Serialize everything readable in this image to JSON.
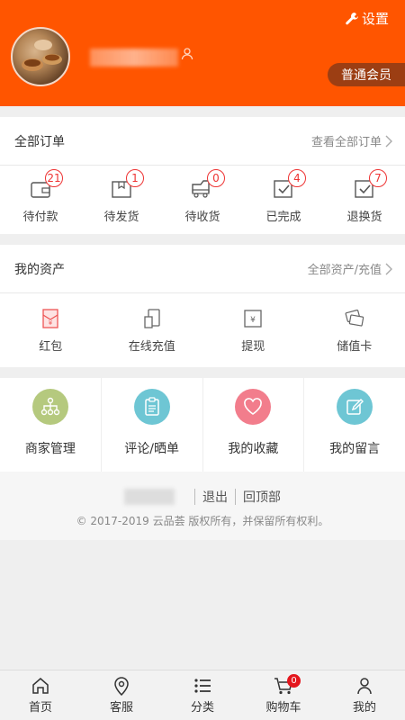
{
  "header": {
    "settings_label": "设置",
    "member_label": "普通会员",
    "accent": "#ff5500"
  },
  "orders": {
    "title": "全部订单",
    "link": "查看全部订单",
    "items": [
      {
        "label": "待付款",
        "badge": "21",
        "icon": "wallet-icon"
      },
      {
        "label": "待发货",
        "badge": "1",
        "icon": "package-icon"
      },
      {
        "label": "待收货",
        "badge": "0",
        "icon": "truck-icon"
      },
      {
        "label": "已完成",
        "badge": "4",
        "icon": "checkbox-icon"
      },
      {
        "label": "退换货",
        "badge": "7",
        "icon": "return-icon"
      }
    ]
  },
  "assets": {
    "title": "我的资产",
    "link": "全部资产/充值",
    "items": [
      {
        "label": "红包",
        "icon": "red-packet-icon"
      },
      {
        "label": "在线充值",
        "icon": "recharge-icon"
      },
      {
        "label": "提现",
        "icon": "withdraw-icon"
      },
      {
        "label": "储值卡",
        "icon": "cards-icon"
      }
    ]
  },
  "tools": [
    {
      "label": "商家管理",
      "icon": "org-chart-icon",
      "color": "#b5c97e"
    },
    {
      "label": "评论/晒单",
      "icon": "clipboard-icon",
      "color": "#6ec6d4"
    },
    {
      "label": "我的收藏",
      "icon": "heart-icon",
      "color": "#f27d8c"
    },
    {
      "label": "我的留言",
      "icon": "edit-icon",
      "color": "#6ec6d4"
    }
  ],
  "footer": {
    "logout": "退出",
    "back_top": "回顶部",
    "copyright": "© 2017-2019 云品荟 版权所有，并保留所有权利。"
  },
  "tabbar": [
    {
      "label": "首页",
      "icon": "home-icon"
    },
    {
      "label": "客服",
      "icon": "location-icon"
    },
    {
      "label": "分类",
      "icon": "list-icon"
    },
    {
      "label": "购物车",
      "icon": "cart-icon",
      "badge": "0"
    },
    {
      "label": "我的",
      "icon": "user-icon"
    }
  ]
}
